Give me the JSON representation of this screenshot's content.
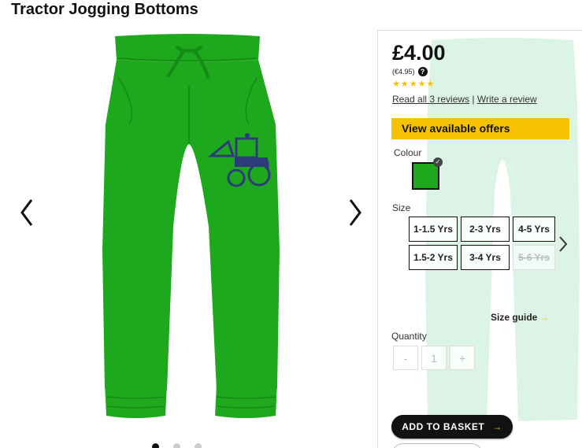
{
  "product": {
    "title": "Tractor Jogging Bottoms",
    "price": "£4.00",
    "price_alt": "(€4.95)",
    "rating": 5,
    "reviews_link": "Read all 3 reviews",
    "separator": "|",
    "write_review": "Write a review"
  },
  "offers": {
    "label": "View available offers"
  },
  "colour": {
    "label": "Colour",
    "selected_color": "#1ea81e"
  },
  "size": {
    "label": "Size",
    "options": [
      {
        "label": "1-1.5 Yrs",
        "available": true
      },
      {
        "label": "2-3 Yrs",
        "available": true
      },
      {
        "label": "4-5 Yrs",
        "available": true
      },
      {
        "label": "1.5-2 Yrs",
        "available": true
      },
      {
        "label": "3-4 Yrs",
        "available": true
      },
      {
        "label": "5-6 Yrs",
        "available": false
      }
    ],
    "guide": "Size guide"
  },
  "quantity": {
    "label": "Quantity",
    "minus": "-",
    "value": "1",
    "plus": "+"
  },
  "basket": {
    "label": "ADD TO BASKET"
  },
  "colors": {
    "product_green": "#1ea81e",
    "accent_yellow": "#f7c300",
    "tractor_blue": "#2e3b7a"
  },
  "gallery": {
    "image_count": 3,
    "active_index": 0
  }
}
